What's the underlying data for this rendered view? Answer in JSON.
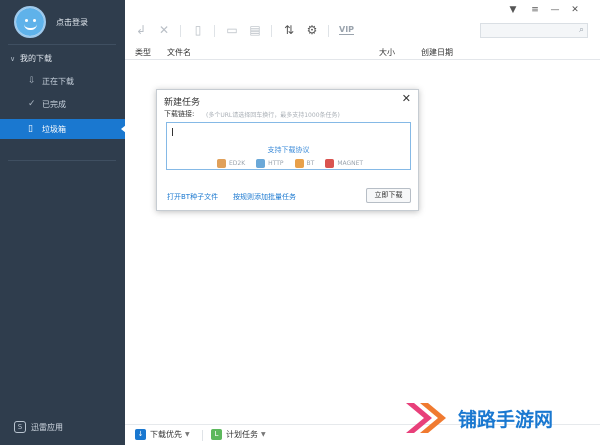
{
  "sidebar": {
    "login_label": "点击登录",
    "group_label": "我的下载",
    "items": [
      {
        "label": "正在下载",
        "icon": "download-arrow-icon"
      },
      {
        "label": "已完成",
        "icon": "check-circle-icon"
      },
      {
        "label": "垃圾箱",
        "icon": "trash-icon",
        "active": true
      }
    ],
    "apps_label": "迅雷应用"
  },
  "toolbar": {
    "icons": [
      "back-icon",
      "close-icon",
      "trash-icon",
      "folder-icon",
      "file-icon",
      "sort-icon",
      "settings-icon"
    ],
    "vip_label": "VIP"
  },
  "table": {
    "headers": [
      "类型",
      "文件名",
      "大小",
      "创建日期"
    ]
  },
  "dialog": {
    "title": "新建任务",
    "link_label": "下载链接:",
    "hint": "(多个URL请选择回车换行，最多支持1000条任务)",
    "support_title": "支持下载协议",
    "protocols": [
      "ED2K",
      "HTTP",
      "BT",
      "MAGNET"
    ],
    "open_torrent": "打开BT种子文件",
    "add_rules": "按规则添加批量任务",
    "download_now": "立即下载"
  },
  "bottombar": {
    "priority_label": "下载优先",
    "schedule_label": "计划任务"
  },
  "watermark": {
    "text": "铺路手游网"
  },
  "colors": {
    "sidebar_bg": "#2f3d4d",
    "accent": "#1a78d0"
  }
}
